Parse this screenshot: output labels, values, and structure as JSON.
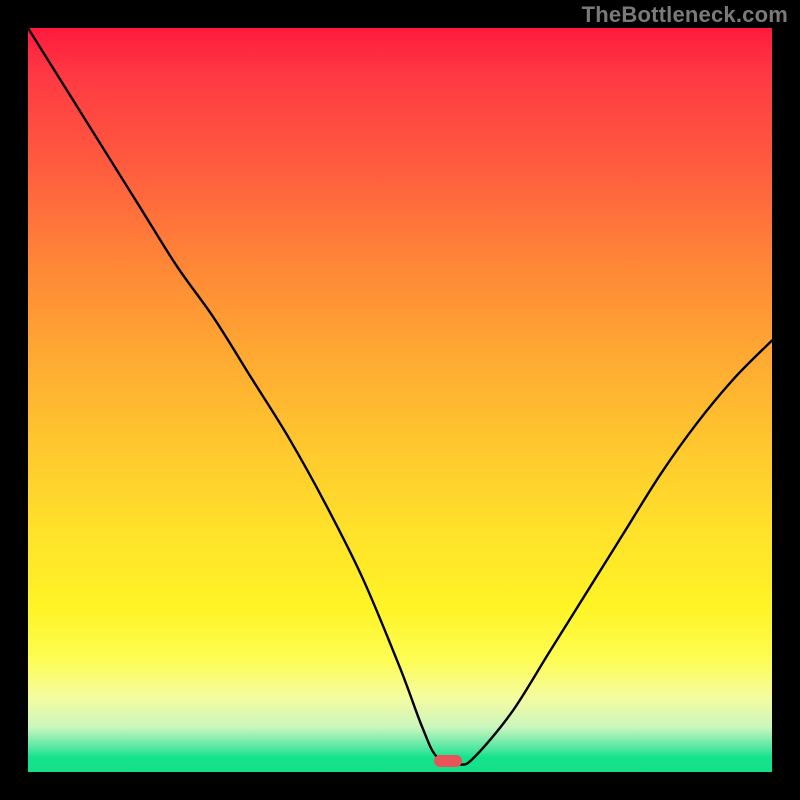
{
  "watermark": "TheBottleneck.com",
  "chart_data": {
    "type": "line",
    "title": "",
    "xlabel": "",
    "ylabel": "",
    "xlim": [
      0,
      100
    ],
    "ylim": [
      0,
      100
    ],
    "series": [
      {
        "name": "bottleneck-curve",
        "x": [
          0,
          5,
          10,
          15,
          20,
          25,
          30,
          35,
          40,
          45,
          50,
          53,
          55,
          58,
          60,
          65,
          70,
          75,
          80,
          85,
          90,
          95,
          100
        ],
        "y": [
          100,
          92,
          84,
          76,
          68,
          61,
          53,
          45,
          36,
          26,
          14,
          6,
          2,
          1,
          2,
          8,
          16,
          24,
          32,
          40,
          47,
          53,
          58
        ]
      }
    ],
    "marker": {
      "x": 56.5,
      "y": 1.5
    },
    "gradient_stops": [
      {
        "pos": 0,
        "color": "#ff1a3e"
      },
      {
        "pos": 6,
        "color": "#ff3843"
      },
      {
        "pos": 18,
        "color": "#ff5a3f"
      },
      {
        "pos": 32,
        "color": "#ff8737"
      },
      {
        "pos": 44,
        "color": "#ffa932"
      },
      {
        "pos": 56,
        "color": "#ffc72e"
      },
      {
        "pos": 68,
        "color": "#ffe22a"
      },
      {
        "pos": 78,
        "color": "#fff426"
      },
      {
        "pos": 85,
        "color": "#fdfd55"
      },
      {
        "pos": 90,
        "color": "#f5fca0"
      },
      {
        "pos": 94,
        "color": "#c9f6bd"
      },
      {
        "pos": 96.5,
        "color": "#5fe8a6"
      },
      {
        "pos": 98,
        "color": "#16e28d"
      },
      {
        "pos": 100,
        "color": "#14e08a"
      }
    ]
  }
}
